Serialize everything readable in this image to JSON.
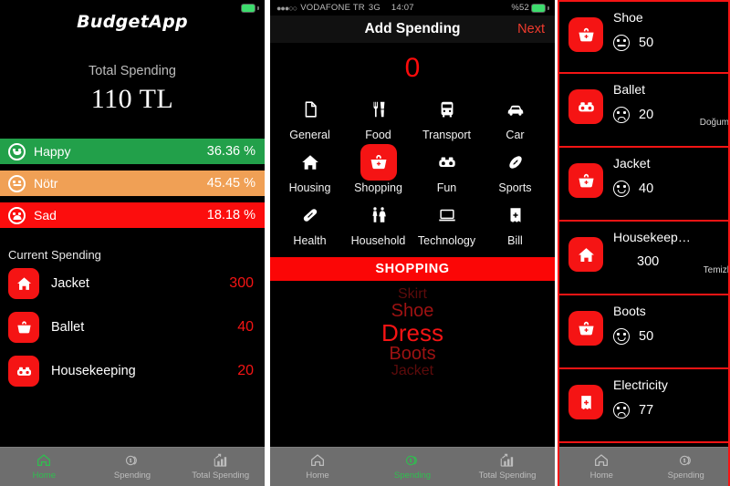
{
  "app": {
    "name": "BudgetApp"
  },
  "panel1": {
    "status": {
      "carrier": "",
      "battery_icon": "battery-icon"
    },
    "total": {
      "label": "Total Spending",
      "value": "110 TL"
    },
    "moods": [
      {
        "name": "Happy",
        "pct": "36.36 %",
        "face": "smile",
        "color": "#22a04a"
      },
      {
        "name": "Nötr",
        "pct": "45.45 %",
        "face": "flat",
        "color": "#f0a055"
      },
      {
        "name": "Sad",
        "pct": "18.18 %",
        "face": "sad",
        "color": "#fc0d0d"
      }
    ],
    "section_title": "Current Spending",
    "spending": [
      {
        "name": "Jacket",
        "amount": "300",
        "icon": "house-icon"
      },
      {
        "name": "Ballet",
        "amount": "40",
        "icon": "basket-icon"
      },
      {
        "name": "Housekeeping",
        "amount": "20",
        "icon": "binoculars-icon"
      }
    ],
    "tabs": [
      {
        "label": "Home",
        "icon": "home-icon",
        "active": true
      },
      {
        "label": "Spending",
        "icon": "coins-icon",
        "active": false
      },
      {
        "label": "Total Spending",
        "icon": "chart-icon",
        "active": false
      }
    ]
  },
  "panel2": {
    "status": {
      "dots": "●●●○○",
      "carrier": "VODAFONE TR",
      "network": "3G",
      "time": "14:07",
      "battery_pct": "%52"
    },
    "nav": {
      "title": "Add Spending",
      "next": "Next"
    },
    "amount": "0",
    "categories": [
      {
        "label": "General",
        "icon": "document-icon",
        "selected": false
      },
      {
        "label": "Food",
        "icon": "cutlery-icon",
        "selected": false
      },
      {
        "label": "Transport",
        "icon": "bus-icon",
        "selected": false
      },
      {
        "label": "Car",
        "icon": "car-icon",
        "selected": false
      },
      {
        "label": "Housing",
        "icon": "house-icon",
        "selected": false
      },
      {
        "label": "Shopping",
        "icon": "basket-icon",
        "selected": true
      },
      {
        "label": "Fun",
        "icon": "binoculars-icon",
        "selected": false
      },
      {
        "label": "Sports",
        "icon": "football-icon",
        "selected": false
      },
      {
        "label": "Health",
        "icon": "pill-icon",
        "selected": false
      },
      {
        "label": "Household",
        "icon": "restroom-icon",
        "selected": false
      },
      {
        "label": "Technology",
        "icon": "laptop-icon",
        "selected": false
      },
      {
        "label": "Bill",
        "icon": "bill-icon",
        "selected": false
      }
    ],
    "banner": "SHOPPING",
    "picker": {
      "items": [
        "Skirt",
        "Shoe",
        "Dress",
        "Boots",
        "Jacket"
      ],
      "selected_index": 2
    },
    "tabs": [
      {
        "label": "Home",
        "icon": "home-icon",
        "active": false
      },
      {
        "label": "Spending",
        "icon": "coins-icon",
        "active": true
      },
      {
        "label": "Total Spending",
        "icon": "chart-icon",
        "active": false
      }
    ]
  },
  "panel3": {
    "rows": [
      {
        "name": "Shoe",
        "amount": "50",
        "face": "flat",
        "icon": "basket-icon",
        "note": ""
      },
      {
        "name": "Ballet",
        "amount": "20",
        "face": "sad",
        "icon": "binoculars-icon",
        "note": "Doğum"
      },
      {
        "name": "Jacket",
        "amount": "40",
        "face": "smile",
        "icon": "basket-icon",
        "note": ""
      },
      {
        "name": "Housekeep…",
        "amount": "300",
        "face": "none",
        "icon": "house-icon",
        "note": "Temizl"
      },
      {
        "name": "Boots",
        "amount": "50",
        "face": "smile",
        "icon": "basket-icon",
        "note": ""
      },
      {
        "name": "Electricity",
        "amount": "77",
        "face": "sad",
        "icon": "bill-icon",
        "note": ""
      }
    ],
    "tabs": [
      {
        "label": "Home",
        "icon": "home-icon",
        "active": false
      },
      {
        "label": "Spending",
        "icon": "coins-icon",
        "active": false
      }
    ]
  }
}
